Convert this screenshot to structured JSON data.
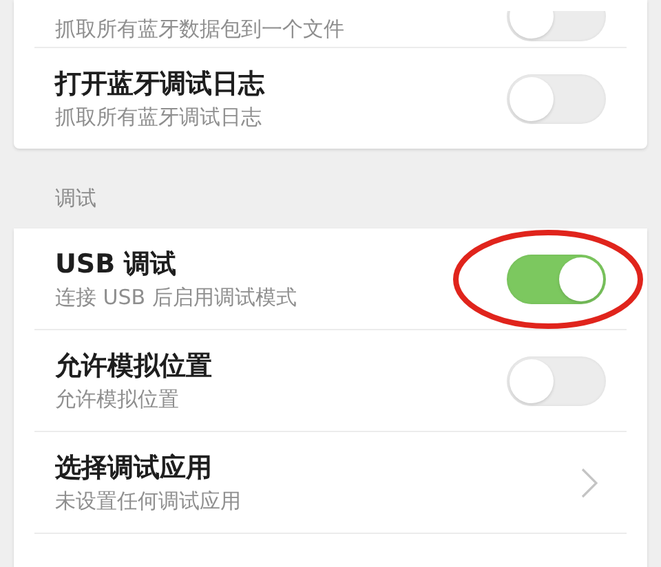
{
  "groups": [
    {
      "items": [
        {
          "kind": "toggle",
          "subtitle": "抓取所有蓝牙数据包到一个文件",
          "on": false
        },
        {
          "kind": "toggle",
          "title": "打开蓝牙调试日志",
          "subtitle": "抓取所有蓝牙调试日志",
          "on": false
        }
      ]
    },
    {
      "header": "调试",
      "items": [
        {
          "kind": "toggle",
          "title": "USB 调试",
          "subtitle": "连接 USB 后启用调试模式",
          "on": true,
          "annotated": true
        },
        {
          "kind": "toggle",
          "title": "允许模拟位置",
          "subtitle": "允许模拟位置",
          "on": false
        },
        {
          "kind": "link",
          "title": "选择调试应用",
          "subtitle": "未设置任何调试应用"
        }
      ]
    }
  ]
}
